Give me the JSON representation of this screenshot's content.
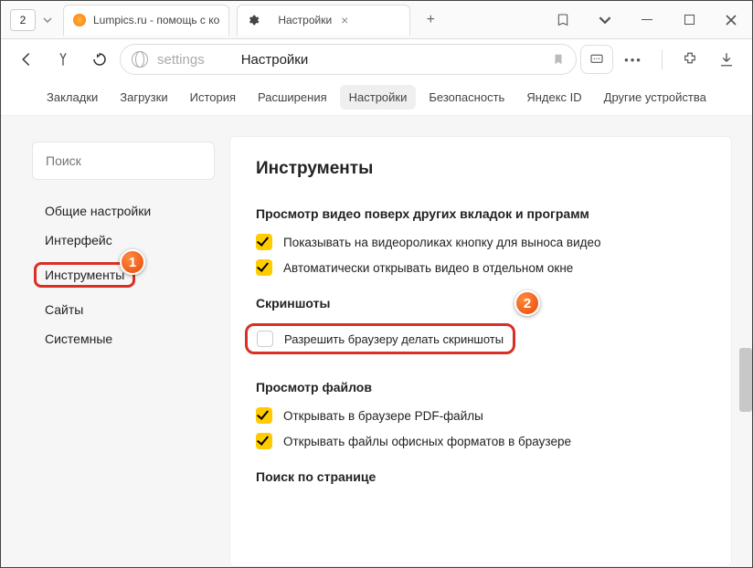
{
  "titlebar": {
    "tab_counter": "2",
    "tabs": [
      {
        "title": "Lumpics.ru - помощь с ко",
        "favicon": "#ff8800"
      },
      {
        "title": "Настройки",
        "favicon_gear": true
      }
    ]
  },
  "addressbar": {
    "host": "settings",
    "path": "Настройки"
  },
  "topnav": {
    "items": [
      "Закладки",
      "Загрузки",
      "История",
      "Расширения",
      "Настройки",
      "Безопасность",
      "Яндекс ID",
      "Другие устройства"
    ],
    "active_index": 4
  },
  "sidebar": {
    "search_placeholder": "Поиск",
    "items": [
      "Общие настройки",
      "Интерфейс",
      "Инструменты",
      "Сайты",
      "Системные"
    ],
    "highlight_index": 2
  },
  "main": {
    "heading": "Инструменты",
    "sections": {
      "video": {
        "title": "Просмотр видео поверх других вкладок и программ",
        "opt1": "Показывать на видеороликах кнопку для выноса видео",
        "opt2": "Автоматически открывать видео в отдельном окне"
      },
      "screenshots": {
        "title": "Скриншоты",
        "opt1": "Разрешить браузеру делать скриншоты"
      },
      "files": {
        "title": "Просмотр файлов",
        "opt1": "Открывать в браузере PDF-файлы",
        "opt2": "Открывать файлы офисных форматов в браузере"
      },
      "search": {
        "title": "Поиск по странице"
      }
    }
  },
  "annotations": {
    "badge1": "1",
    "badge2": "2"
  }
}
